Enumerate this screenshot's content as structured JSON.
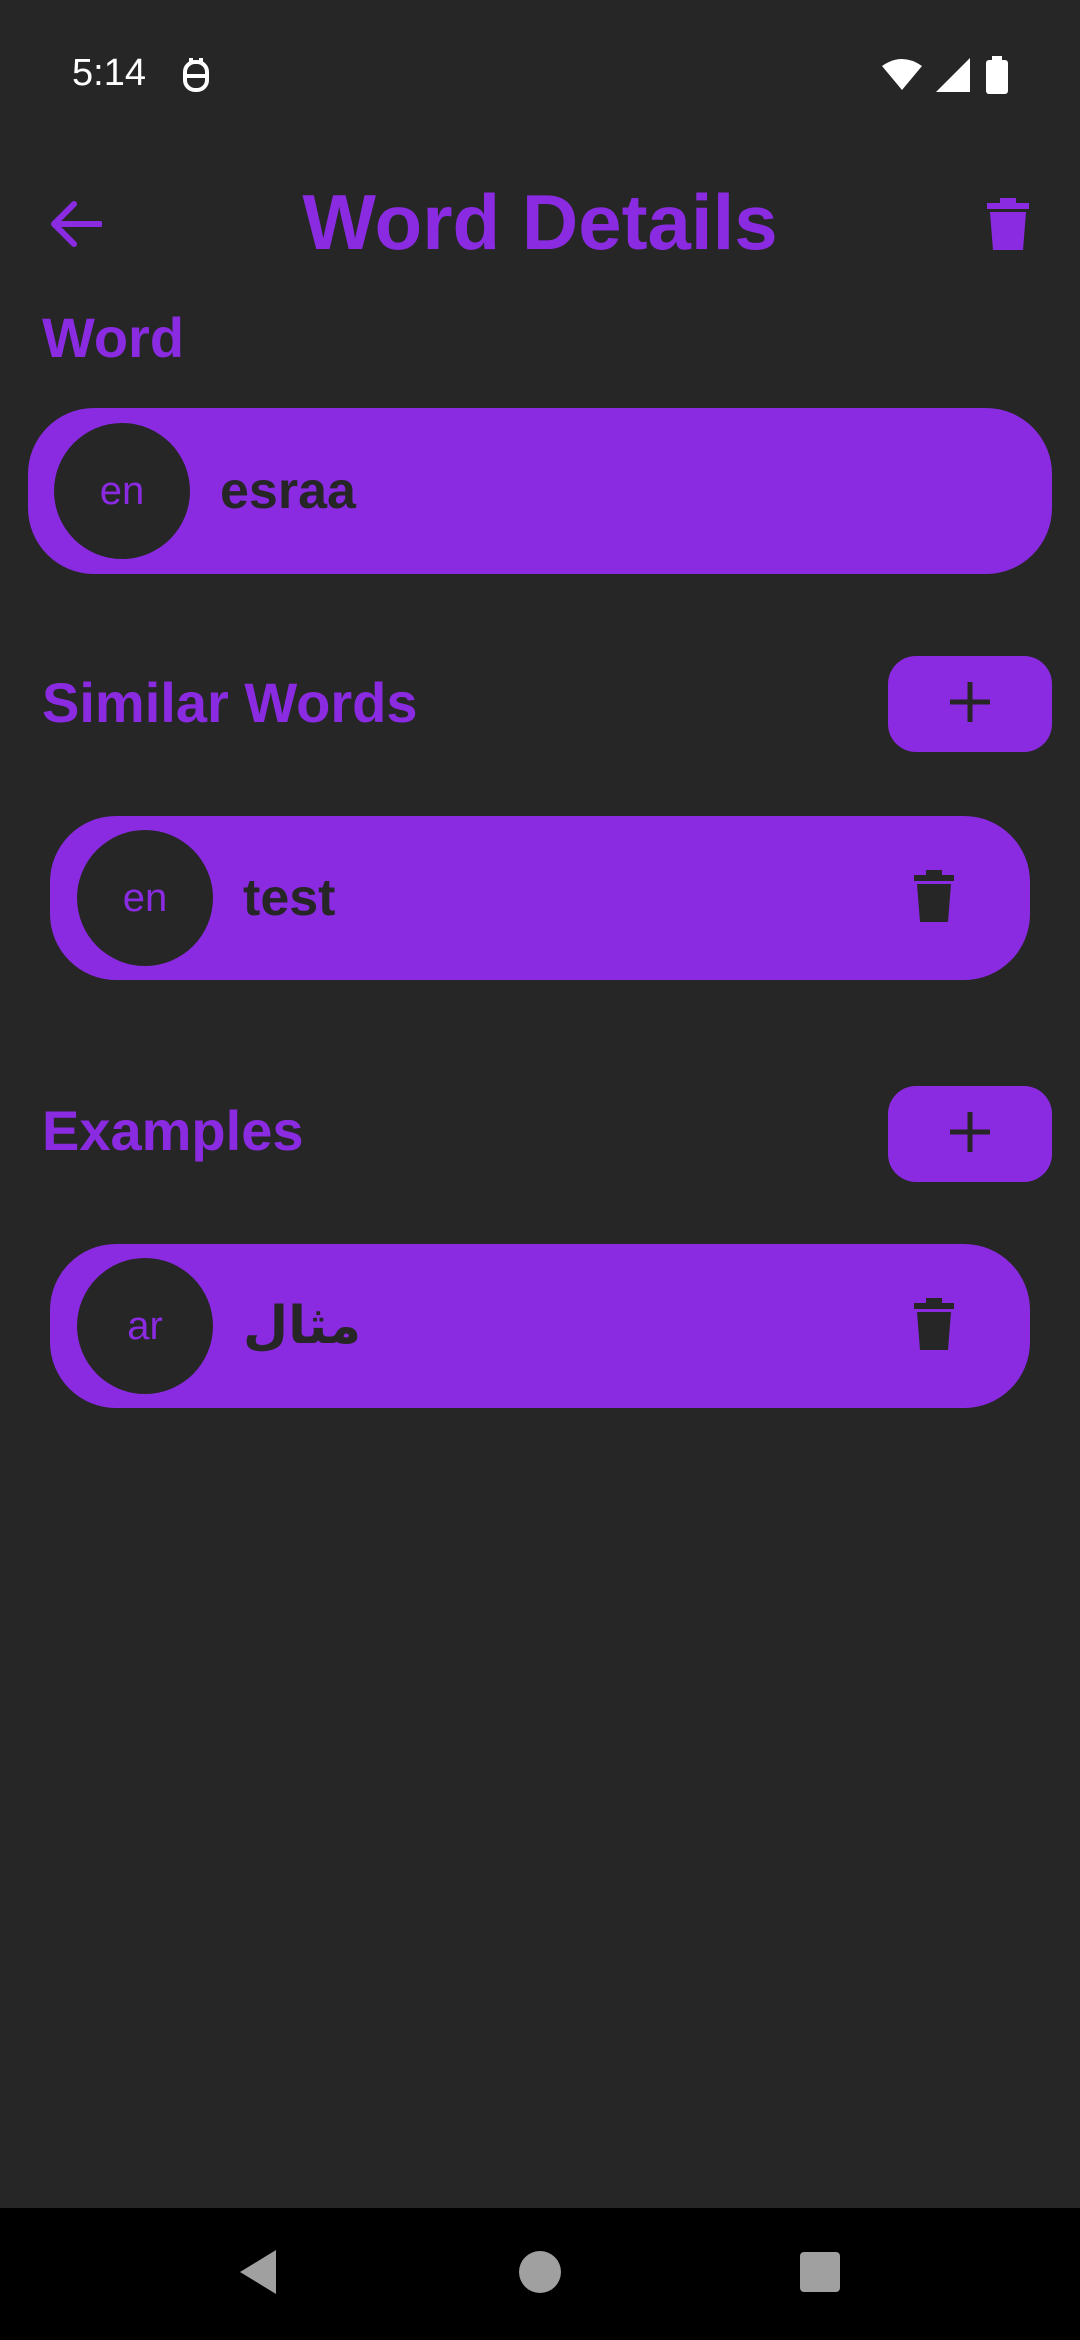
{
  "status_bar": {
    "time": "5:14",
    "icons": [
      "notification-icon",
      "wifi-icon",
      "signal-icon",
      "battery-icon"
    ]
  },
  "app_bar": {
    "title": "Word Details",
    "back_icon": "arrow-left-icon",
    "delete_icon": "trash-icon"
  },
  "word_section": {
    "title": "Word",
    "word": {
      "lang": "en",
      "text": "esraa"
    }
  },
  "similar_section": {
    "title": "Similar Words",
    "add_icon": "plus-icon",
    "items": [
      {
        "lang": "en",
        "text": "test"
      }
    ]
  },
  "examples_section": {
    "title": "Examples",
    "add_icon": "plus-icon",
    "items": [
      {
        "lang": "ar",
        "text": "مثال"
      }
    ]
  },
  "nav_bar": {
    "buttons": [
      "back-triangle-icon",
      "home-circle-icon",
      "recents-square-icon"
    ]
  },
  "colors": {
    "accent": "#8A2BE2",
    "background": "#262626",
    "nav_background": "#000000"
  }
}
